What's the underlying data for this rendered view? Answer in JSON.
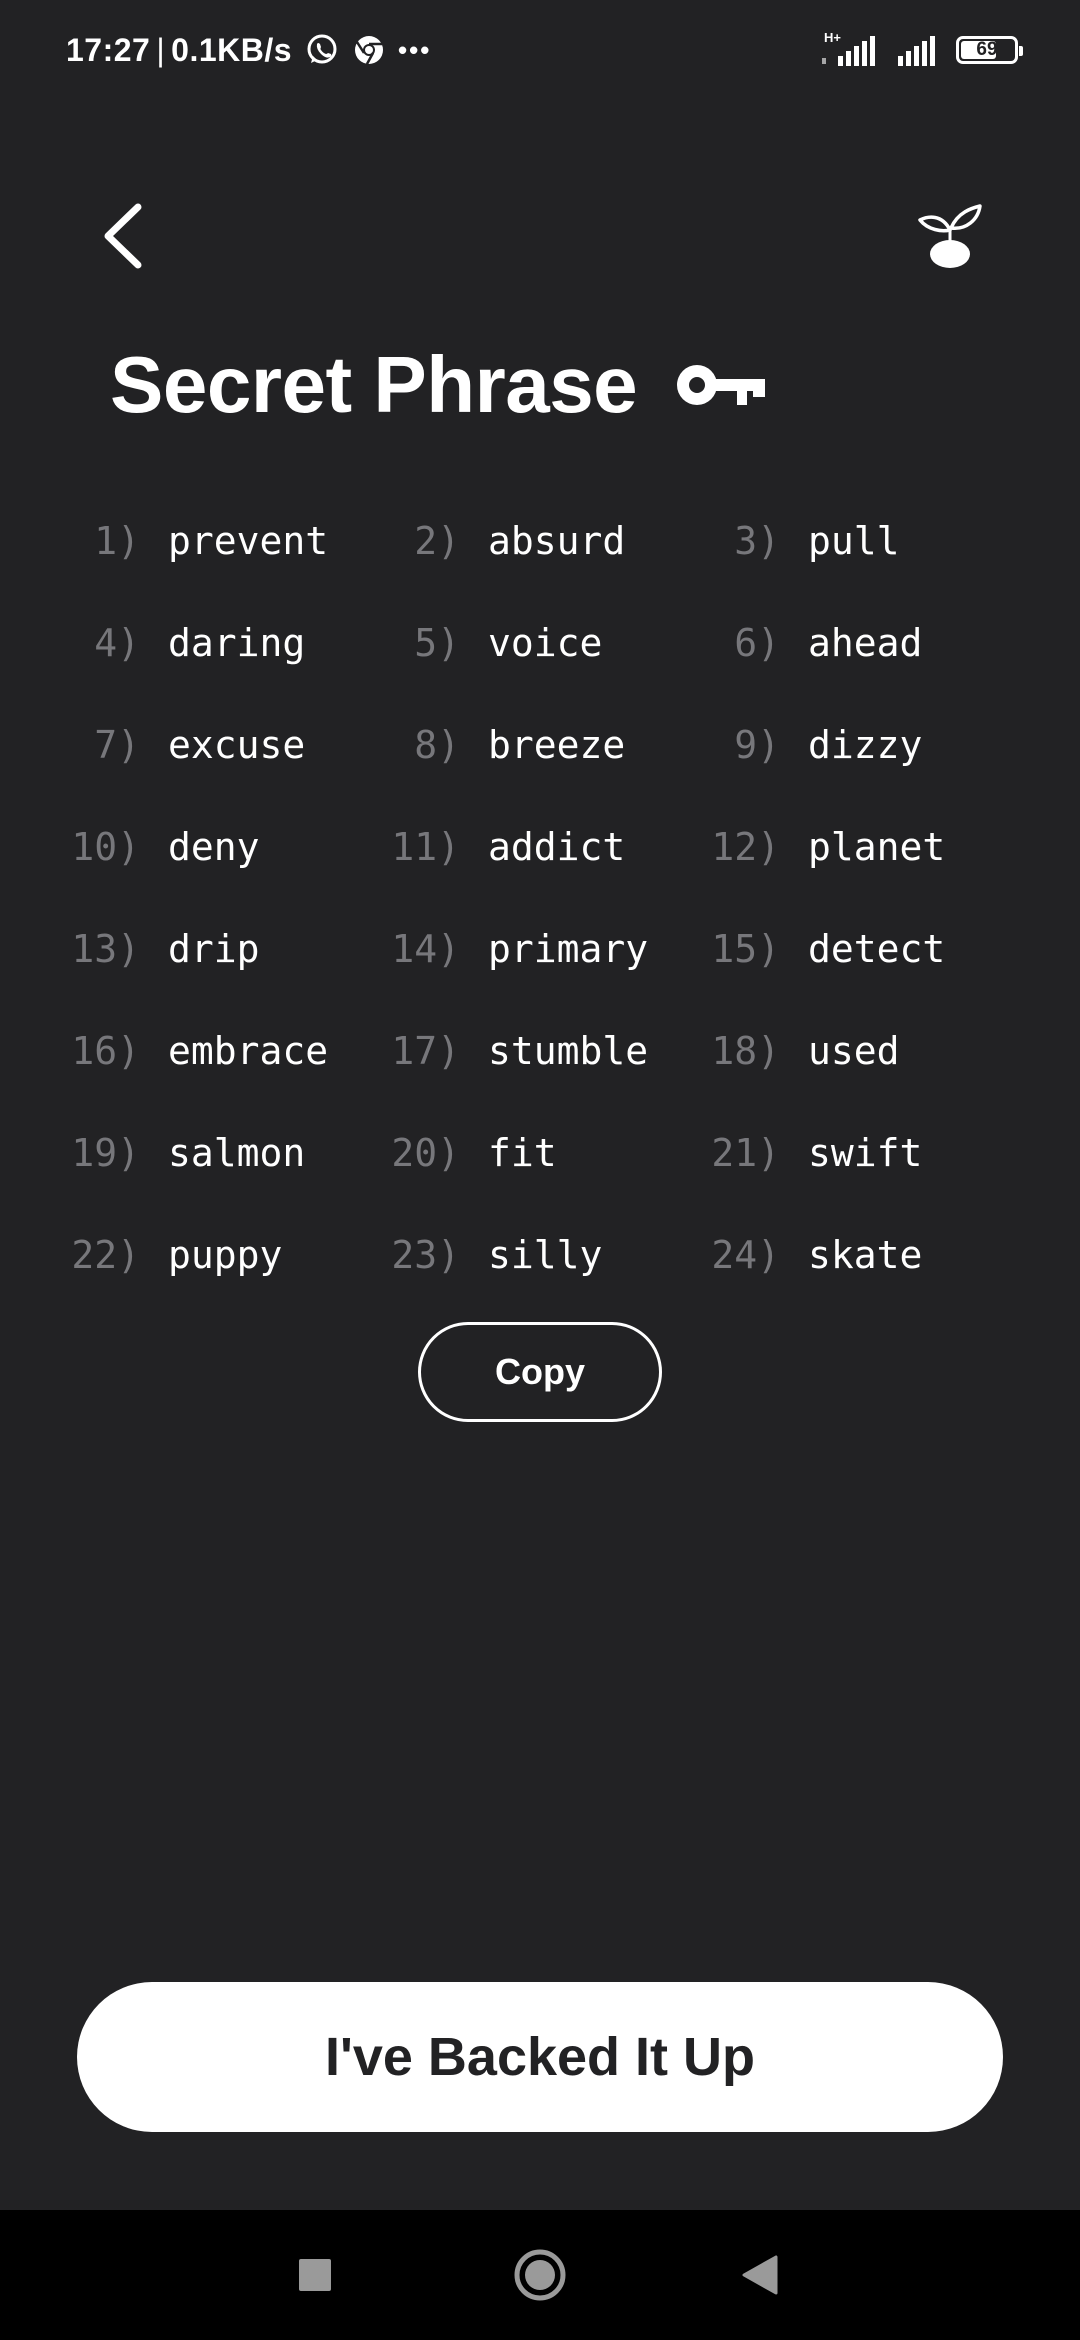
{
  "status_bar": {
    "time": "17:27",
    "separator": "|",
    "net_speed": "0.1KB/s",
    "more": "•••",
    "network_type": "H+",
    "battery_level": "69"
  },
  "header": {
    "title": "Secret Phrase"
  },
  "icons": {
    "back": "chevron-left-icon",
    "plant": "sprout-icon",
    "key": "key-icon"
  },
  "seed_words": [
    {
      "num": "1)",
      "word": "prevent"
    },
    {
      "num": "2)",
      "word": "absurd"
    },
    {
      "num": "3)",
      "word": "pull"
    },
    {
      "num": "4)",
      "word": "daring"
    },
    {
      "num": "5)",
      "word": "voice"
    },
    {
      "num": "6)",
      "word": "ahead"
    },
    {
      "num": "7)",
      "word": "excuse"
    },
    {
      "num": "8)",
      "word": "breeze"
    },
    {
      "num": "9)",
      "word": "dizzy"
    },
    {
      "num": "10)",
      "word": "deny"
    },
    {
      "num": "11)",
      "word": "addict"
    },
    {
      "num": "12)",
      "word": "planet"
    },
    {
      "num": "13)",
      "word": "drip"
    },
    {
      "num": "14)",
      "word": "primary"
    },
    {
      "num": "15)",
      "word": "detect"
    },
    {
      "num": "16)",
      "word": "embrace"
    },
    {
      "num": "17)",
      "word": "stumble"
    },
    {
      "num": "18)",
      "word": "used"
    },
    {
      "num": "19)",
      "word": "salmon"
    },
    {
      "num": "20)",
      "word": "fit"
    },
    {
      "num": "21)",
      "word": "swift"
    },
    {
      "num": "22)",
      "word": "puppy"
    },
    {
      "num": "23)",
      "word": "silly"
    },
    {
      "num": "24)",
      "word": "skate"
    }
  ],
  "actions": {
    "copy_label": "Copy",
    "backed_up_label": "I've Backed It Up"
  },
  "colors": {
    "background": "#222224",
    "text": "#ffffff",
    "muted": "#77777b",
    "nav_bar": "#000000"
  }
}
